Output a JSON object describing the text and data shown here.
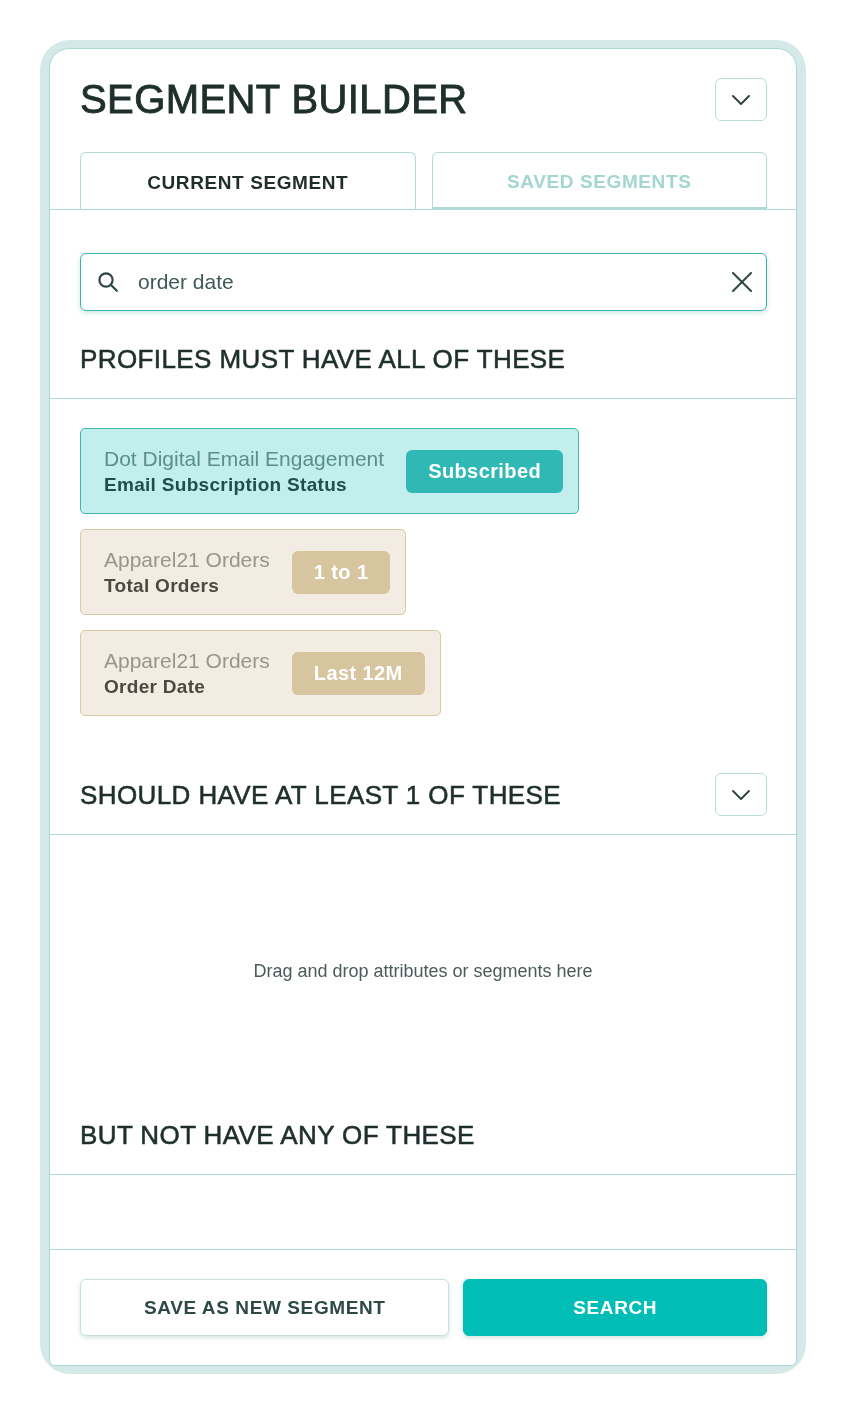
{
  "header": {
    "title": "SEGMENT BUILDER"
  },
  "tabs": [
    {
      "label": "CURRENT SEGMENT",
      "selected": true
    },
    {
      "label": "SAVED SEGMENTS",
      "selected": false
    }
  ],
  "search": {
    "value": "order date"
  },
  "sections": [
    {
      "title": "PROFILES MUST HAVE ALL OF THESE",
      "collapsible": false,
      "criteria": [
        {
          "kind": "engagement",
          "source": "Dot Digital Email Engagement",
          "attribute": "Email Subscription Status",
          "value": "Subscribed"
        },
        {
          "kind": "orders",
          "source": "Apparel21 Orders",
          "attribute": "Total Orders",
          "value": "1 to 1"
        },
        {
          "kind": "orders",
          "source": "Apparel21 Orders",
          "attribute": "Order Date",
          "value": "Last 12M"
        }
      ]
    },
    {
      "title": "SHOULD HAVE AT LEAST 1 OF THESE",
      "collapsible": true,
      "empty_hint": "Drag and drop attributes or segments here"
    },
    {
      "title": "BUT NOT HAVE ANY OF THESE",
      "collapsible": false
    }
  ],
  "footer": {
    "buttons": [
      {
        "label": "SAVE AS NEW SEGMENT",
        "kind": "secondary"
      },
      {
        "label": "SEARCH",
        "kind": "primary"
      }
    ]
  }
}
